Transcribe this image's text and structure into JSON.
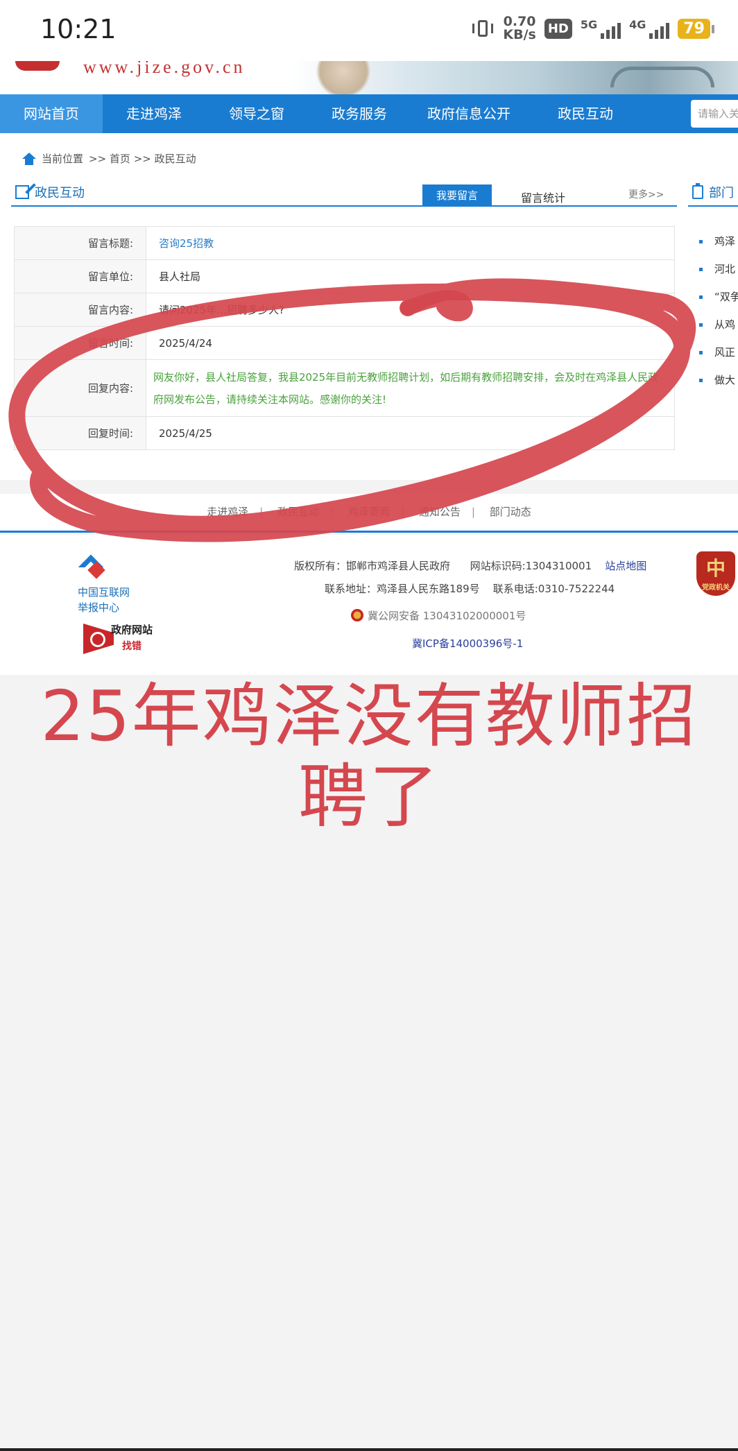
{
  "status_bar": {
    "time": "10:21",
    "speed_value": "0.70",
    "speed_unit": "KB/s",
    "hd": "HD",
    "sim": "12",
    "net1": "5G",
    "net2": "4G",
    "battery": "79"
  },
  "site": {
    "url": "www.jize.gov.cn"
  },
  "nav": {
    "items": [
      "网站首页",
      "走进鸡泽",
      "领导之窗",
      "政务服务",
      "政府信息公开",
      "政民互动"
    ],
    "search_placeholder": "请输入关"
  },
  "breadcrumb": {
    "label": "当前位置",
    "path": ">> 首页 >> 政民互动"
  },
  "section": {
    "title": "政民互动",
    "tab_active": "我要留言",
    "tab_stats": "留言统计",
    "more": "更多>>"
  },
  "sidebar": {
    "title": "部门",
    "items": [
      "鸡泽",
      "河北",
      "“双争",
      "从鸡",
      "风正",
      "做大"
    ]
  },
  "detail": {
    "rows": [
      {
        "key": "留言标题:",
        "value": "咨询25招教"
      },
      {
        "key": "留言单位:",
        "value": "县人社局"
      },
      {
        "key": "留言内容:",
        "value": "请问2025年…招聘多少人?"
      },
      {
        "key": "留言时间:",
        "value": "2025/4/24"
      },
      {
        "key": "回复内容:",
        "value": "网友你好，县人社局答复，我县2025年目前无教师招聘计划，如后期有教师招聘安排，会及时在鸡泽县人民政府网发布公告，请持续关注本网站。感谢你的关注!"
      },
      {
        "key": "回复时间:",
        "value": "2025/4/25"
      }
    ]
  },
  "footer": {
    "links": [
      "走进鸡泽",
      "政民互动",
      "鸡泽要闻",
      "通知公告",
      "部门动态"
    ],
    "report_center_line1": "中国互联网",
    "report_center_line2": "举报中心",
    "gov_site_line1": "政府网站",
    "gov_site_line2": "找错",
    "copyright": "版权所有：邯郸市鸡泽县人民政府",
    "site_id": "网站标识码:1304310001",
    "sitemap": "站点地图",
    "address": "联系地址：鸡泽县人民东路189号",
    "phone": "联系电话:0310-7522244",
    "police": "冀公网安备 13043102000001号",
    "icp": "冀ICP备14000396号-1",
    "badge_text": "党政机关"
  },
  "caption": {
    "line1": "25年鸡泽没有教师招",
    "line2": "聘了"
  },
  "colors": {
    "nav_blue": "#1a7cd1",
    "annotation_red": "#d5474e",
    "reply_green": "#4aa13d"
  }
}
